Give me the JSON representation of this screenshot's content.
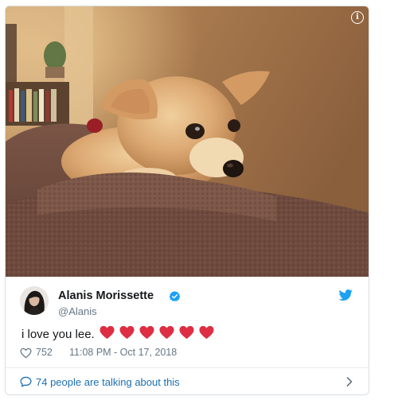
{
  "tweet": {
    "author_name": "Alanis Morissette",
    "author_handle": "@Alanis",
    "verified": true,
    "text": "i love you lee.",
    "emoji": [
      "heart",
      "heart",
      "heart",
      "heart",
      "heart",
      "heart"
    ],
    "like_count": "752",
    "timestamp": "11:08 PM - Oct 17, 2018",
    "conversation": "74 people are talking about this"
  },
  "icons": {
    "info": "info-icon",
    "verified": "verified-badge-icon",
    "brand": "twitter-bird-icon",
    "like": "heart-outline-icon",
    "reply": "comment-bubble-icon",
    "more": "chevron-right-icon"
  },
  "colors": {
    "twitter_blue": "#1da1f2",
    "link_blue": "#1b6fb3",
    "heart_red": "#dd2e44",
    "muted_text": "#657786",
    "primary_text": "#14171a"
  }
}
